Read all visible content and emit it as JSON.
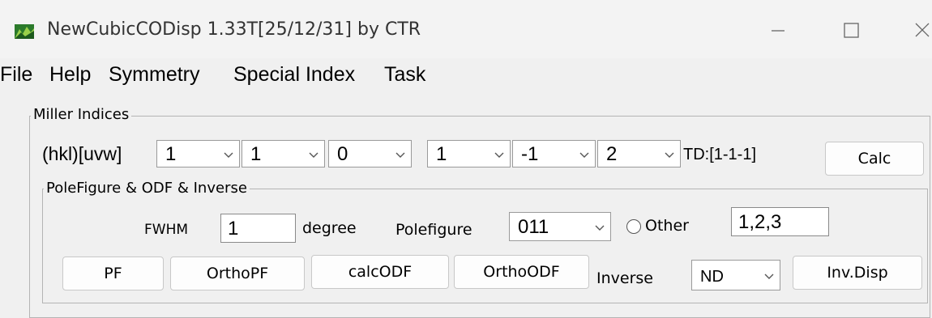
{
  "window": {
    "title": "NewCubicCODisp 1.33T[25/12/31] by CTR",
    "icon": "app-icon",
    "controls": [
      "minimize-icon",
      "maximize-icon",
      "close-icon"
    ]
  },
  "menu": {
    "file": "File",
    "help": "Help",
    "symmetry": "Symmetry",
    "special_index": "Special Index",
    "task": "Task"
  },
  "miller": {
    "group_label": "Miller Indices",
    "hkl_label": "(hkl)[uvw]",
    "h": "1",
    "k": "1",
    "l": "0",
    "u": "1",
    "v": "-1",
    "w": "2",
    "td_label": "TD:[1-1-1]",
    "calc_button": "Calc"
  },
  "pole": {
    "group_label": "PoleFigure & ODF & Inverse",
    "fwhm_label": "FWHM",
    "fwhm_value": "1",
    "degree_label": "degree",
    "polefigure_label": "Polefigure",
    "polefigure_value": "011",
    "other_label": "Other",
    "other_value": "1,2,3",
    "pf_button": "PF",
    "orthopf_button": "OrthoPF",
    "calcodf_button": "calcODF",
    "orthoodf_button": "OrthoODF",
    "inverse_label": "Inverse",
    "inverse_value": "ND",
    "invdisp_button": "Inv.Disp"
  }
}
